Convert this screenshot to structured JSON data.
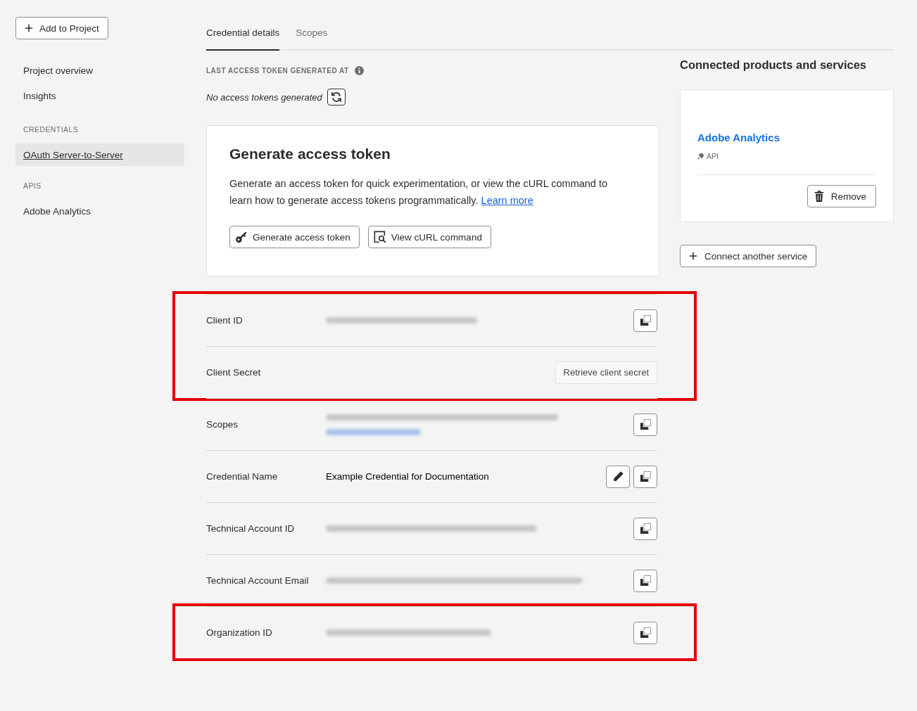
{
  "sidebar": {
    "add_button": "Add to Project",
    "items": [
      {
        "kind": "link",
        "label": "Project overview",
        "selected": false
      },
      {
        "kind": "link",
        "label": "Insights",
        "selected": false
      },
      {
        "kind": "heading",
        "label": "CREDENTIALS"
      },
      {
        "kind": "link",
        "label": "OAuth Server-to-Server",
        "selected": true
      },
      {
        "kind": "heading",
        "label": "APIS"
      },
      {
        "kind": "link",
        "label": "Adobe Analytics",
        "selected": false
      }
    ]
  },
  "tabs": [
    {
      "label": "Credential details",
      "selected": true
    },
    {
      "label": "Scopes",
      "selected": false
    }
  ],
  "token_status": {
    "label": "LAST ACCESS TOKEN GENERATED AT",
    "value": "No access tokens generated"
  },
  "generate_card": {
    "title": "Generate access token",
    "text": "Generate an access token for quick experimentation, or view the cURL command to learn how to generate access tokens programmatically.",
    "link": "Learn more",
    "buttons": [
      {
        "kind": "key",
        "label": "Generate access token"
      },
      {
        "kind": "curl",
        "label": "View cURL command"
      }
    ]
  },
  "credential_groups": [
    {
      "highlighted": true,
      "rows": [
        {
          "label": "Client ID",
          "blurred": [
            {
              "kind": "text"
            }
          ],
          "actions": [
            {
              "kind": "copy"
            }
          ]
        },
        {
          "label": "Client Secret",
          "actions": [
            {
              "kind": "button",
              "label": "Retrieve client secret"
            }
          ]
        }
      ]
    },
    {
      "highlighted": false,
      "rows": [
        {
          "label": "Scopes",
          "blurred": [
            {
              "kind": "text"
            },
            {
              "kind": "link"
            }
          ],
          "actions": [
            {
              "kind": "copy"
            }
          ]
        },
        {
          "label": "Credential Name",
          "value": "Example Credential for Documentation",
          "actions": [
            {
              "kind": "edit"
            },
            {
              "kind": "copy"
            }
          ]
        },
        {
          "label": "Technical Account ID",
          "blurred": [
            {
              "kind": "text"
            }
          ],
          "actions": [
            {
              "kind": "copy"
            }
          ]
        },
        {
          "label": "Technical Account Email",
          "blurred": [
            {
              "kind": "text"
            }
          ],
          "actions": [
            {
              "kind": "copy"
            }
          ]
        }
      ]
    },
    {
      "highlighted": true,
      "rows": [
        {
          "label": "Organization ID",
          "blurred": [
            {
              "kind": "text"
            }
          ],
          "actions": [
            {
              "kind": "copy"
            }
          ]
        }
      ]
    }
  ],
  "connected": {
    "title": "Connected products and services",
    "services": [
      {
        "name": "Adobe Analytics",
        "type": "API",
        "remove_button": "Remove"
      }
    ],
    "connect_button": "Connect another service"
  }
}
